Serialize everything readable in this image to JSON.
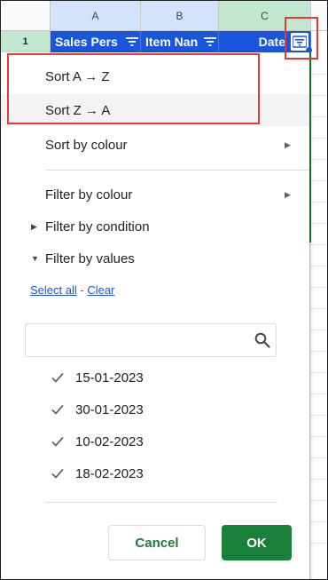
{
  "sheet": {
    "columns": [
      "A",
      "B",
      "C"
    ],
    "row_number": "1",
    "headers": [
      "Sales Pers",
      "Item Nan",
      "Date"
    ]
  },
  "menu": {
    "sort_az": "Sort A → Z",
    "sort_za": "Sort Z → A",
    "sort_by_colour": "Sort by colour",
    "filter_by_colour": "Filter by colour",
    "filter_by_condition": "Filter by condition",
    "filter_by_values": "Filter by values",
    "select_all": "Select all",
    "link_separator": " - ",
    "clear": "Clear",
    "search_value": "",
    "values": [
      "15-01-2023",
      "30-01-2023",
      "10-02-2023",
      "18-02-2023"
    ],
    "cancel": "Cancel",
    "ok": "OK"
  },
  "colors": {
    "header_fill": "#1a56db",
    "ok_button": "#188038",
    "highlight": "#e53935"
  },
  "icons": {
    "filter": "filter-icon",
    "submenu": "triangle-right-icon",
    "check": "check-icon",
    "search": "search-icon"
  }
}
